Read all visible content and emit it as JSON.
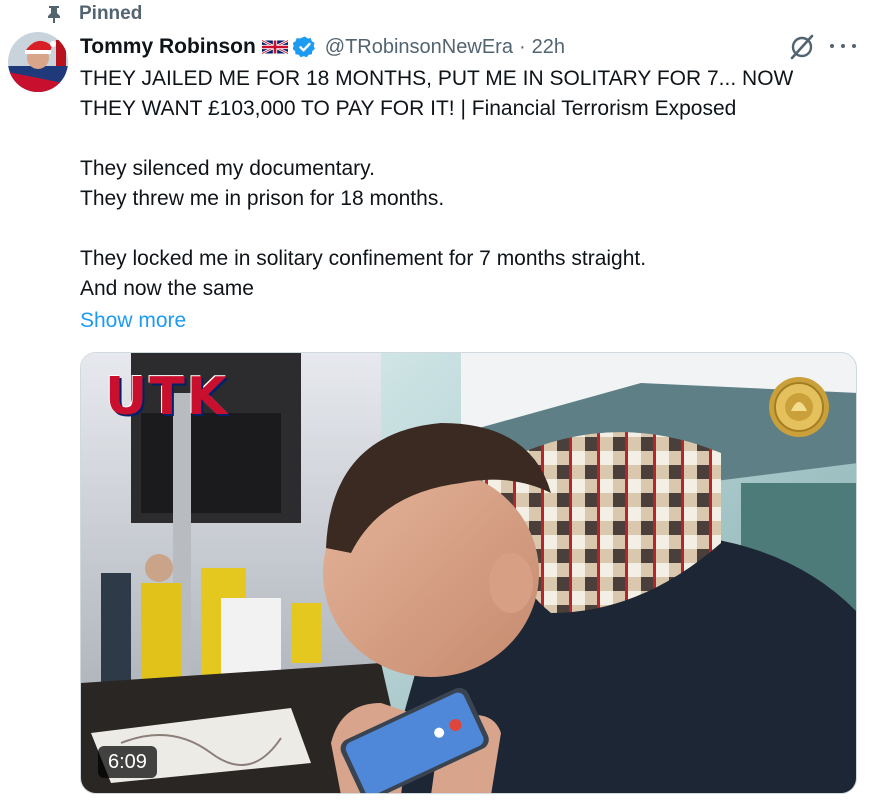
{
  "pinned": {
    "label": "Pinned"
  },
  "author": {
    "name": "Tommy Robinson",
    "handle": "@TRobinsonNewEra",
    "time": "22h"
  },
  "tweet": {
    "lines": [
      "THEY JAILED ME FOR 18 MONTHS, PUT ME IN SOLITARY FOR 7... NOW",
      "THEY WANT £103,000 TO PAY FOR IT! | Financial Terrorism Exposed",
      "",
      "They silenced my documentary.",
      "They threw me in prison for 18 months.",
      "",
      "They locked me in solitary confinement for 7 months straight.",
      "And now the same"
    ],
    "show_more": "Show more"
  },
  "media": {
    "logo_text": "UTK",
    "duration": "6:09"
  },
  "colors": {
    "link": "#1d9bf0",
    "secondary_text": "#536471",
    "verified": "#1d9bf0"
  }
}
